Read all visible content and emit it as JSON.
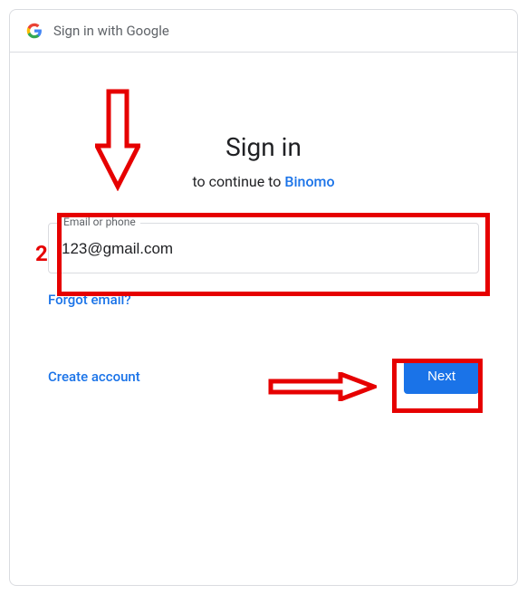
{
  "header": {
    "title": "Sign in with Google"
  },
  "main": {
    "title": "Sign in",
    "subtitle_static": "to continue to ",
    "subtitle_link": "Binomo",
    "input_label": "Email or phone",
    "input_value": "123@gmail.com",
    "forgot_link": "Forgot email?",
    "create_link": "Create account",
    "next_button": "Next"
  },
  "annotations": {
    "step_number": "2"
  }
}
